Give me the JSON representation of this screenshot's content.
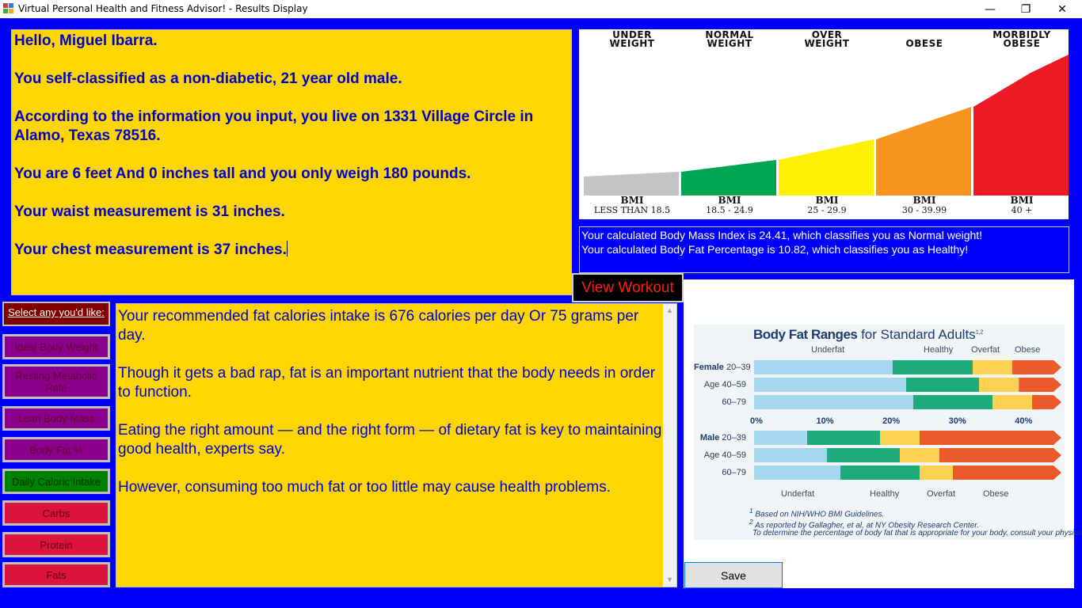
{
  "window": {
    "title": "Virtual Personal Health and Fitness Advisor! - Results Display",
    "min_glyph": "—",
    "max_glyph": "❐",
    "close_glyph": "✕"
  },
  "info": {
    "greeting": "Hello, Miguel Ibarra.",
    "classification": "You self-classified as a non-diabetic, 21 year old male.",
    "address": "According to the information you input, you live on 1331 Village Circle in Alamo, Texas 78516.",
    "height_weight": "You are 6 feet And 0 inches tall and you only weigh 180 pounds.",
    "waist": "Your waist measurement is 31 inches.",
    "chest": "Your chest measurement is 37 inches."
  },
  "bmi_chart": {
    "categories": [
      {
        "line1": "UNDER",
        "line2": "WEIGHT",
        "bmi": "BMI",
        "range": "LESS THAN 18.5",
        "color": "#c4c4c4",
        "level": 0.17
      },
      {
        "line1": "NORMAL",
        "line2": "WEIGHT",
        "bmi": "BMI",
        "range": "18.5 - 24.9",
        "color": "#00a551",
        "level": 0.25
      },
      {
        "line1": "OVER",
        "line2": "WEIGHT",
        "bmi": "BMI",
        "range": "25 - 29.9",
        "color": "#ffef00",
        "level": 0.4
      },
      {
        "line1": "",
        "line2": "OBESE",
        "bmi": "BMI",
        "range": "30 - 39.99",
        "color": "#f7941d",
        "level": 0.63
      },
      {
        "line1": "MORBIDLY",
        "line2": "OBESE",
        "bmi": "BMI",
        "range": "40 +",
        "color": "#ed1c24",
        "level": 1.0
      }
    ]
  },
  "results": {
    "bmi_text": "Your calculated Body Mass Index is 24.41, which classifies you as Normal weight!",
    "body_fat_text": "Your calculated Body Fat Percentage is 10.82, which classifies you as Healthy!"
  },
  "buttons": {
    "view_workout": "View Workout",
    "save": "Save"
  },
  "menu": {
    "header": "Select any you'd like:",
    "items": [
      {
        "label": "Ideal Body Weight",
        "color": "purple"
      },
      {
        "label": "Resting Metabolic Rate",
        "color": "purple"
      },
      {
        "label": "Lean Body Mass",
        "color": "purple"
      },
      {
        "label": "Body Fat %",
        "color": "purple"
      },
      {
        "label": "Daily Caloric Intake",
        "color": "green"
      },
      {
        "label": "Carbs",
        "color": "red"
      },
      {
        "label": "Protein",
        "color": "red"
      },
      {
        "label": "Fats",
        "color": "red"
      }
    ]
  },
  "content": {
    "p1": "Your recommended fat calories intake is 676 calories per day Or 75 grams per day.",
    "p2": "Though it gets a bad rap, fat is an important nutrient that the body needs in order to function.",
    "p3": "Eating the right amount — and the right form — of dietary fat is key to maintaining good health, experts say.",
    "p4": "However, consuming too much fat or too little may cause health problems.",
    "scroll_up": "▲",
    "scroll_down": "▼"
  },
  "body_fat_chart": {
    "title_bold": "Body Fat Ranges",
    "title_rest": " for Standard Adults",
    "title_sup": "1,2",
    "top_categories": [
      "Underfat",
      "Healthy",
      "Overfat",
      "Obese"
    ],
    "bottom_categories": [
      "Underfat",
      "Healthy",
      "Overfat",
      "Obese"
    ],
    "ticks": [
      "0%",
      "10%",
      "20%",
      "30%",
      "40%"
    ],
    "female_label": "Female",
    "male_label": "Male",
    "age_word": "Age",
    "rows": [
      {
        "group": "female",
        "age": "20–39",
        "bounds": [
          21,
          33,
          39
        ]
      },
      {
        "group": "female",
        "age": "40–59",
        "bounds": [
          23,
          34,
          40
        ]
      },
      {
        "group": "female",
        "age": "60–79",
        "bounds": [
          24,
          36,
          42
        ]
      },
      {
        "group": "male",
        "age": "20–39",
        "bounds": [
          8,
          19,
          25
        ]
      },
      {
        "group": "male",
        "age": "40–59",
        "bounds": [
          11,
          22,
          28
        ]
      },
      {
        "group": "male",
        "age": "60–79",
        "bounds": [
          13,
          25,
          30
        ]
      }
    ],
    "segment_colors": [
      "#a6d7f0",
      "#1fab7a",
      "#fad24f",
      "#ec5a2c"
    ],
    "note1": "Based on NIH/WHO BMI Guidelines.",
    "note2": "As reported by Gallagher, et al, at NY Obesity Research Center.",
    "note3": "To determine the percentage of body fat that is appropriate for your body, consult your physician.",
    "note1_mark": "1",
    "note2_mark": "2"
  }
}
